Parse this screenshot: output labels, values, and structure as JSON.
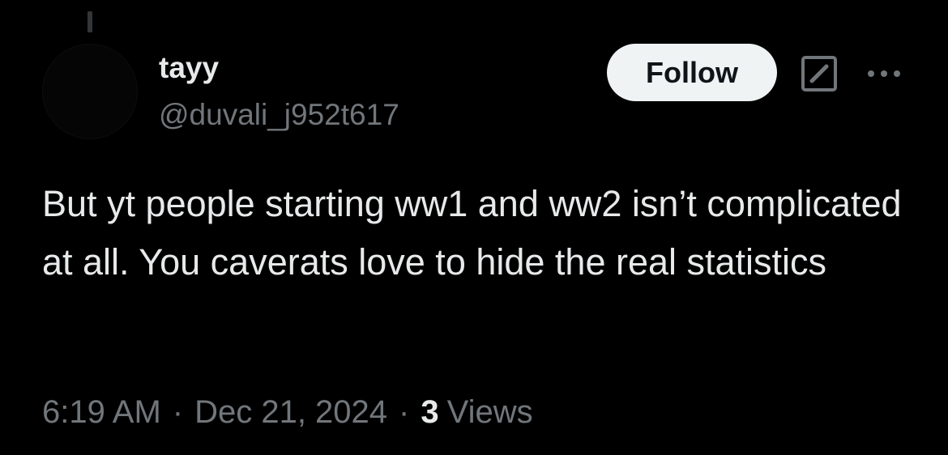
{
  "tweet": {
    "author": {
      "display_name": "tayy",
      "handle": "@duvali_j952t617"
    },
    "follow_label": "Follow",
    "text": "But yt people starting ww1 and ww2 isn’t complicated at all. You caverats love to hide the real statistics",
    "time": "6:19 AM",
    "date": "Dec 21, 2024",
    "separator": "·",
    "views_count": "3",
    "views_label": "Views"
  },
  "icons": {
    "grok": "grok-icon",
    "more": "more-options-icon"
  },
  "colors": {
    "background": "#000000",
    "primary_text": "#e7e9ea",
    "secondary_text": "#71767b",
    "follow_button_bg": "#eff3f4",
    "follow_button_text": "#0f1419"
  }
}
